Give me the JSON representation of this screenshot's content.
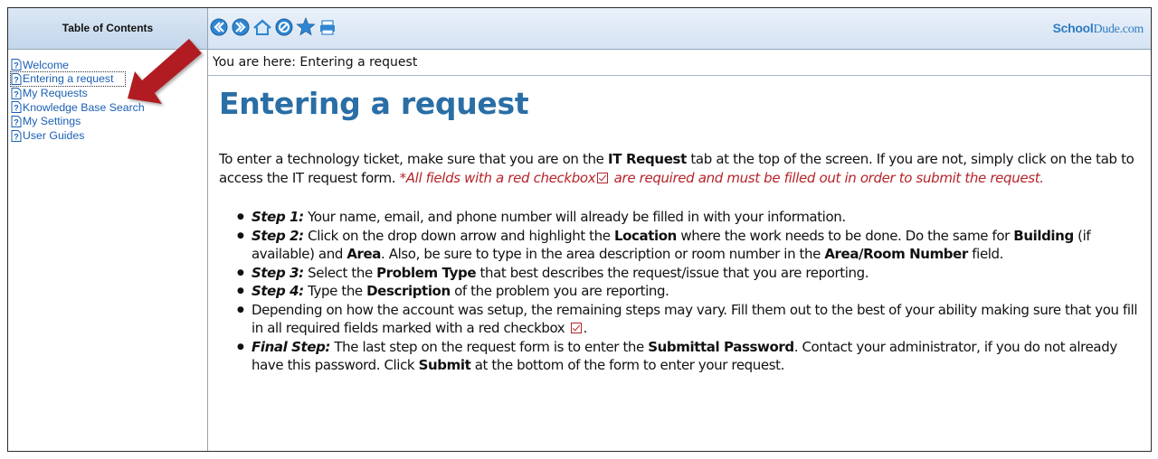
{
  "toc": {
    "title": "Table of Contents",
    "items": [
      {
        "label": "Welcome"
      },
      {
        "label": "Entering a request",
        "active": true
      },
      {
        "label": "My Requests"
      },
      {
        "label": "Knowledge Base Search"
      },
      {
        "label": "My Settings"
      },
      {
        "label": "User Guides"
      }
    ]
  },
  "toolbar": {
    "buttons": [
      "back-icon",
      "forward-icon",
      "home-icon",
      "stop-icon",
      "favorites-icon",
      "print-icon"
    ],
    "brand_bold": "School",
    "brand_regular": "Dude.com"
  },
  "breadcrumb": "You are here: Entering a request",
  "page": {
    "title": "Entering a request",
    "intro": {
      "part1": "To enter a technology ticket, make sure that you are on the ",
      "bold1": "IT Request",
      "part2": " tab at the top of the screen. If you are not, simply click on the tab to access the IT request form. ",
      "req1": "*All fields with a red checkbox",
      "req2": " are required and must be filled out in order to submit the request."
    },
    "steps": [
      {
        "name": "Step 1:",
        "segments": [
          {
            "t": " Your name, email, and phone number will already be filled in with your information."
          }
        ]
      },
      {
        "name": "Step 2:",
        "segments": [
          {
            "t": " Click on the drop down arrow and highlight the "
          },
          {
            "b": "Location"
          },
          {
            "t": " where the work needs to be done. Do the same for "
          },
          {
            "b": "Building"
          },
          {
            "t": " (if available) and "
          },
          {
            "b": "Area"
          },
          {
            "t": ". Also, be sure to type in the area description or room number in the "
          },
          {
            "b": "Area/Room Number"
          },
          {
            "t": " field."
          }
        ]
      },
      {
        "name": "Step 3:",
        "segments": [
          {
            "t": " Select the "
          },
          {
            "b": "Problem Type"
          },
          {
            "t": " that best describes the request/issue that you are reporting."
          }
        ]
      },
      {
        "name": "Step 4:",
        "segments": [
          {
            "t": " Type the "
          },
          {
            "b": "Description"
          },
          {
            "t": " of the problem you are reporting."
          }
        ]
      },
      {
        "name": "",
        "segments": [
          {
            "t": "Depending on how the account was setup, the remaining steps may vary. Fill them out to the best of your ability making sure that you fill in all required fields marked with a red checkbox "
          },
          {
            "check": true
          },
          {
            "t": "."
          }
        ]
      },
      {
        "name": "Final Step:",
        "segments": [
          {
            "t": " The last step on the request form is to enter the "
          },
          {
            "b": "Submittal Password"
          },
          {
            "t": ". Contact your administrator, if you do not already have this password. Click "
          },
          {
            "b": "Submit"
          },
          {
            "t": " at the bottom of the form to enter your request."
          }
        ]
      }
    ]
  },
  "colors": {
    "accent": "#2a6ea6",
    "link": "#1a5fb4",
    "required": "#b5242a",
    "arrow": "#b01e23"
  }
}
